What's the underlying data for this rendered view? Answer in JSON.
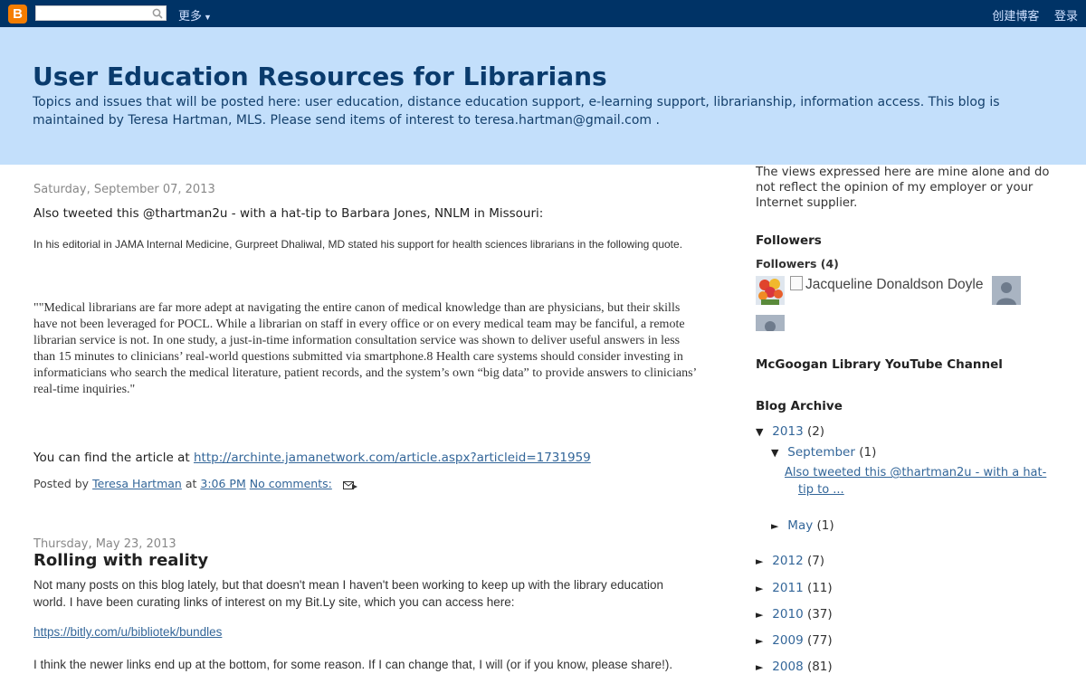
{
  "navbar": {
    "logo_letter": "B",
    "search_placeholder": "",
    "more_label": "更多",
    "create_blog": "创建博客",
    "login": "登录"
  },
  "header": {
    "title": "User Education Resources for Librarians",
    "description": "Topics and issues that will be posted here: user education, distance education support, e-learning support, librarianship, information access. This blog is maintained by Teresa Hartman, MLS. Please send items of interest to teresa.hartman@gmail.com ."
  },
  "posts": [
    {
      "date": "Saturday, September 07, 2013",
      "intro": "Also tweeted this @thartman2u - with a hat-tip to Barbara Jones, NNLM in Missouri:",
      "editorial": "In his editorial in JAMA Internal Medicine, Gurpreet Dhaliwal, MD stated his support for health sciences librarians in the following quote.",
      "quote": "\"\"Medical librarians are far more adept at navigating the entire canon of medical knowledge than are physicians, but their skills have not been leveraged for POCL. While a librarian on staff in every office or on every medical team may be fanciful, a remote librarian service is not. In one study, a just-in-time information consultation service was shown to deliver useful answers in less than 15 minutes to clinicians’ real-world questions submitted via smartphone.8 Health care systems should consider investing in informaticians who search the medical literature, patient records, and the system’s own “big data” to provide answers to clinicians’ real-time inquiries.\"",
      "find_prefix": "You can find the article at",
      "article_link": "http://archinte.jamanetwork.com/article.aspx?articleid=1731959",
      "posted_by": "Posted by",
      "author": "Teresa Hartman",
      "at": "at",
      "time": "3:06 PM",
      "comments": "No comments:"
    },
    {
      "date": "Thursday, May 23, 2013",
      "title": "Rolling with reality",
      "para1": "Not many posts on this blog lately, but that doesn't mean I haven't been working to keep up with the library education world. I have been curating links of interest on my Bit.Ly site, which you can access here:",
      "link": "https://bitly.com/u/bibliotek/bundles",
      "para2": "I think the newer links end up at the bottom, for some reason. If I can change that, I will (or if you know, please share!)."
    }
  ],
  "sidebar": {
    "disclaimer": "The views expressed here are mine alone and do not reflect the opinion of my employer or your Internet supplier.",
    "followers_heading": "Followers",
    "followers_count": "Followers (4)",
    "follower_alt": "Jacqueline Donaldson Doyle",
    "youtube_heading": "McGoogan Library YouTube Channel",
    "archive_heading": "Blog Archive",
    "archive": {
      "y2013": {
        "label": "2013",
        "count": "(2)",
        "open_marker": "▼"
      },
      "september": {
        "label": "September",
        "count": "(1)",
        "open_marker": "▼"
      },
      "sep_post": "Also tweeted this @thartman2u - with a hat-tip to ...",
      "may": {
        "label": "May",
        "count": "(1)",
        "closed_marker": "►"
      },
      "years": [
        {
          "label": "2012",
          "count": "(7)"
        },
        {
          "label": "2011",
          "count": "(11)"
        },
        {
          "label": "2010",
          "count": "(37)"
        },
        {
          "label": "2009",
          "count": "(77)"
        },
        {
          "label": "2008",
          "count": "(81)"
        }
      ],
      "closed_marker": "►"
    }
  },
  "colors": {
    "navbar_bg": "#003366",
    "header_bg": "#c3dffb",
    "title_color": "#0a3b6d",
    "link_color": "#336699",
    "logo_orange": "#f57d00"
  }
}
